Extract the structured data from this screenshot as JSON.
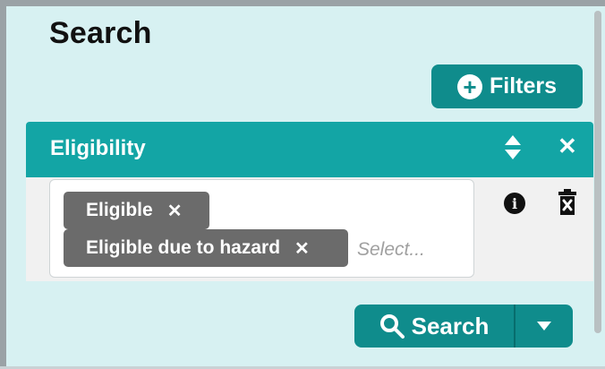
{
  "page": {
    "title": "Search"
  },
  "toolbar": {
    "filters_label": "Filters"
  },
  "eligibility": {
    "title": "Eligibility",
    "tags": [
      {
        "label": "Eligible",
        "remove": "✕"
      },
      {
        "label": "Eligible due to hazard",
        "remove": "✕"
      }
    ],
    "placeholder": "Select...",
    "close_symbol": "✕",
    "info_symbol": "i"
  },
  "actions": {
    "search_label": "Search"
  },
  "colors": {
    "background": "#d7f1f2",
    "accent": "#0f8c8c",
    "header": "#13a5a5",
    "tag": "#6b6b6b"
  },
  "icons": [
    "plus-circle-icon",
    "sort-icon",
    "close-icon",
    "info-icon",
    "trash-icon",
    "search-icon",
    "caret-down-icon"
  ]
}
